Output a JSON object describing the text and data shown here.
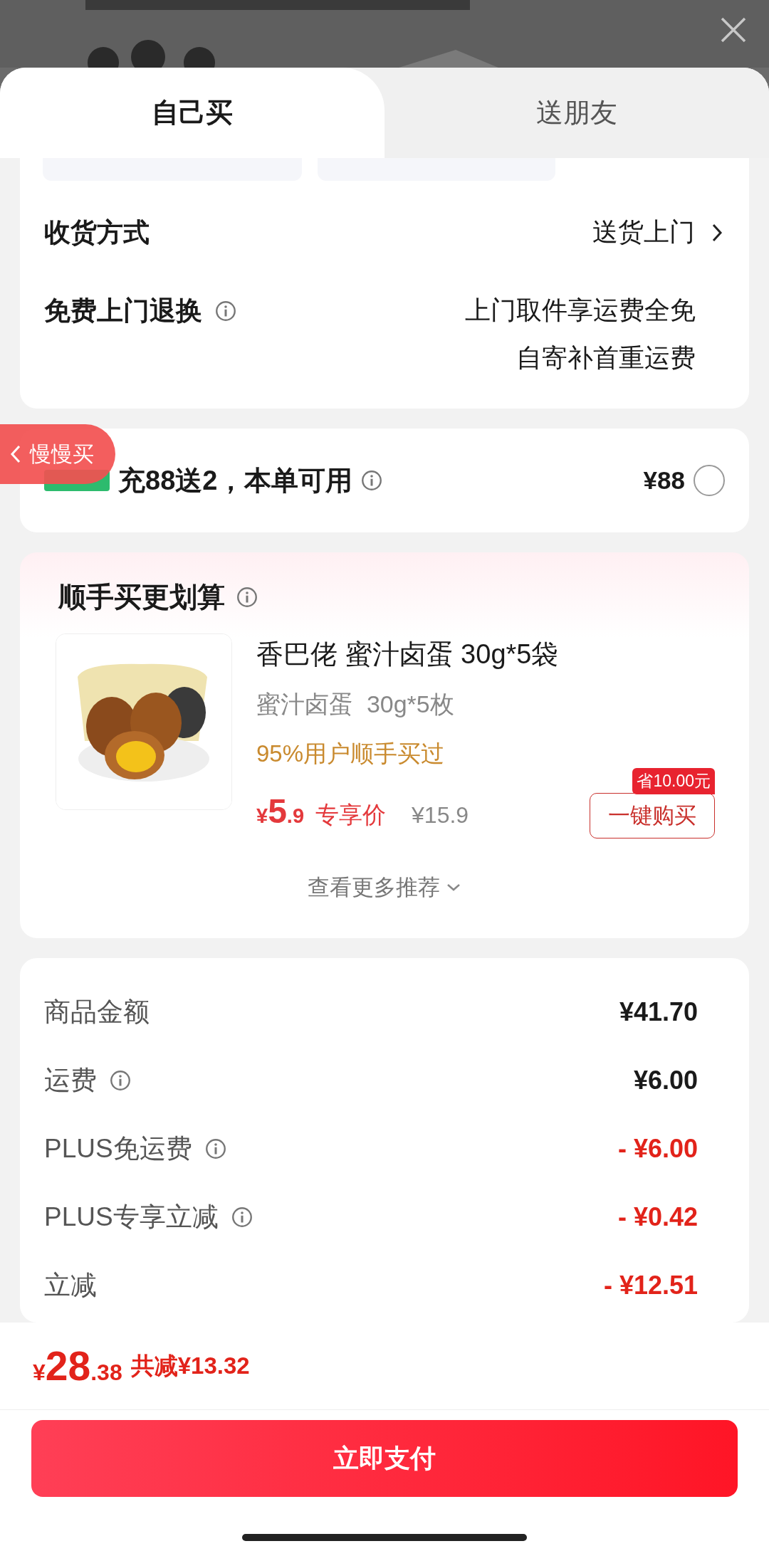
{
  "tabs": [
    {
      "label": "自己买",
      "selected": true
    },
    {
      "label": "送朋友",
      "selected": false
    }
  ],
  "delivery": {
    "rows": [
      {
        "label": "收货方式",
        "info": false,
        "lines": [
          "送货上门"
        ],
        "arrow": true
      },
      {
        "label": "免费上门退换",
        "info": true,
        "lines": [
          "上门取件享运费全免",
          "自寄补首重运费"
        ],
        "arrow": false
      }
    ]
  },
  "card_offer": {
    "text": "充88送2，本单可用",
    "info": true,
    "price": "¥88",
    "checked": false
  },
  "float_button": {
    "label": "慢慢买"
  },
  "recommend": {
    "title": "顺手买更划算",
    "product": {
      "name": "香巴佬 蜜汁卤蛋 30g*5袋",
      "spec": "蜜汁卤蛋  30g*5枚",
      "social": "95%用户顺手买过",
      "price_symbol": "¥",
      "price_integer": "5",
      "price_decimal": ".9",
      "price_tag": "专享价",
      "original_price": "¥15.9",
      "saving_badge": "省10.00元",
      "buy_button": "一键购买"
    },
    "more": "查看更多推荐"
  },
  "summary": {
    "rows": [
      {
        "label": "商品金额",
        "info": false,
        "value": "¥41.70",
        "discount": false
      },
      {
        "label": "运费",
        "info": true,
        "value": "¥6.00",
        "discount": false
      },
      {
        "label": "PLUS免运费",
        "info": true,
        "value": "- ¥6.00",
        "discount": true
      },
      {
        "label": "PLUS专享立减",
        "info": true,
        "value": "- ¥0.42",
        "discount": true
      },
      {
        "label": "立减",
        "info": false,
        "value": "- ¥12.51",
        "discount": true
      }
    ]
  },
  "footer": {
    "symbol": "¥",
    "integer": "28",
    "decimal": ".38",
    "savings": "共减¥13.32",
    "pay_button": "立即支付"
  }
}
